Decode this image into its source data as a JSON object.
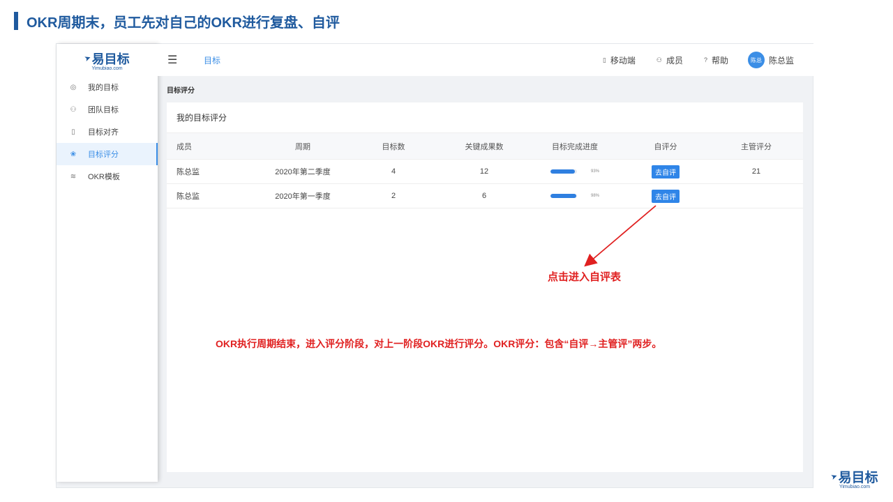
{
  "slide": {
    "title": "OKR周期末，员工先对自己的OKR进行复盘、自评"
  },
  "logo": {
    "main": "易目标",
    "sub": "Yimubiao.com",
    "icon": "paper-plane-icon"
  },
  "sidebar": {
    "items": [
      {
        "label": "我的目标",
        "icon": "target-icon",
        "active": false
      },
      {
        "label": "团队目标",
        "icon": "team-icon",
        "active": false
      },
      {
        "label": "目标对齐",
        "icon": "book-icon",
        "active": false
      },
      {
        "label": "目标评分",
        "icon": "award-icon",
        "active": true
      },
      {
        "label": "OKR模板",
        "icon": "layers-icon",
        "active": false
      }
    ]
  },
  "topbar": {
    "menu_icon": "hamburger-icon",
    "breadcrumb": "目标",
    "mobile_label": "移动端",
    "members_label": "成员",
    "help_label": "帮助",
    "avatar_text": "陈总",
    "user_name": "陈总监"
  },
  "section_title": "目标评分",
  "panel": {
    "title": "我的目标评分",
    "columns": [
      "成员",
      "周期",
      "目标数",
      "关键成果数",
      "目标完成进度",
      "自评分",
      "主管评分"
    ],
    "rows": [
      {
        "member": "陈总监",
        "period": "2020年第二季度",
        "goals": "4",
        "krs": "12",
        "progress": 0.93,
        "progress_label": "93%",
        "self_button": "去自评",
        "manager_score": "21"
      },
      {
        "member": "陈总监",
        "period": "2020年第一季度",
        "goals": "2",
        "krs": "6",
        "progress": 0.98,
        "progress_label": "98%",
        "self_button": "去自评",
        "manager_score": ""
      }
    ]
  },
  "annotations": {
    "click_hint": "点击进入自评表",
    "description": "OKR执行周期结束，进入评分阶段，对上一阶段OKR进行评分。OKR评分：包含“自评→主管评”两步。",
    "arrow_color": "#e02020"
  },
  "brand": {
    "main": "易目标",
    "sub": "Yimubiao.com"
  },
  "colors": {
    "accent": "#3b8ee6",
    "title": "#1f5a9e",
    "annotation": "#e02020",
    "button": "#2f85e8"
  }
}
